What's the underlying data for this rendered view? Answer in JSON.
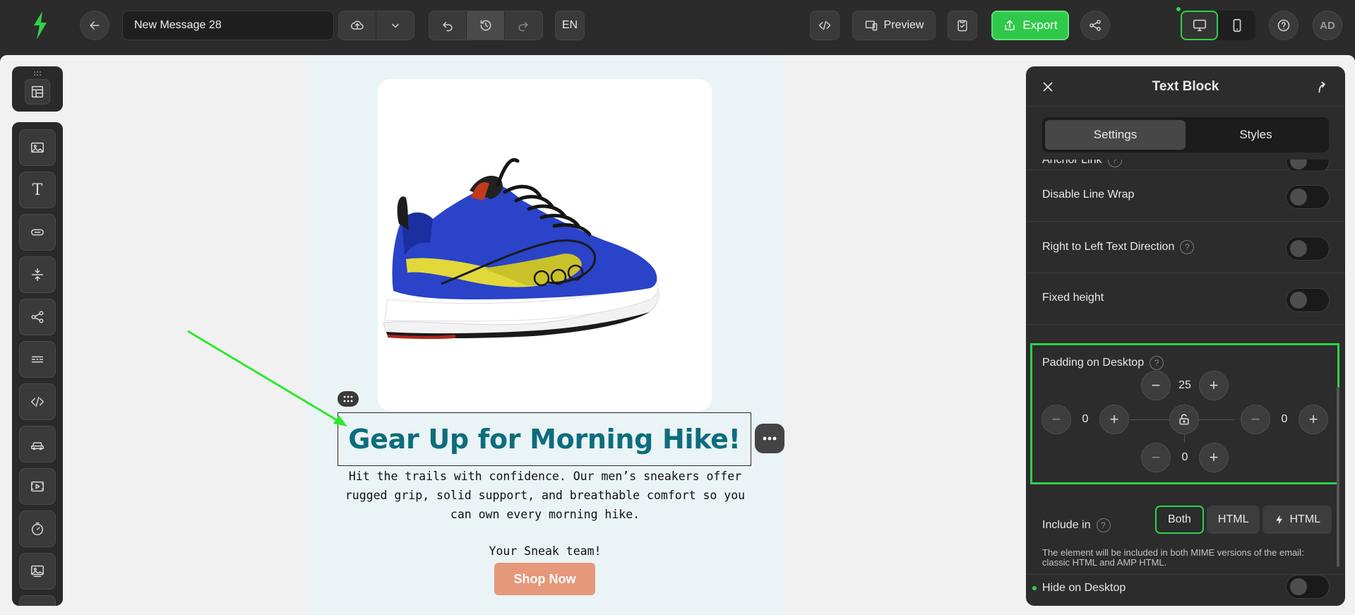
{
  "topbar": {
    "message_title": "New Message 28",
    "language": "EN",
    "preview_label": "Preview",
    "export_label": "Export",
    "avatar_initials": "AD"
  },
  "canvas": {
    "headline": "Gear Up for Morning Hike!",
    "body": "Hit the trails with confidence. Our men’s sneakers offer rugged grip, solid support, and breathable comfort so you can own every morning hike.",
    "signoff": "Your Sneak team!",
    "cta_label": "Shop Now"
  },
  "panel": {
    "title": "Text Block",
    "tabs": [
      {
        "label": "Settings"
      },
      {
        "label": "Styles"
      }
    ],
    "settings": {
      "anchor_link": "Anchor Link",
      "disable_line_wrap": "Disable Line Wrap",
      "rtl_direction": "Right to Left Text Direction",
      "fixed_height": "Fixed height",
      "padding_label": "Padding on Desktop",
      "padding": {
        "top": "25",
        "left": "0",
        "right": "0",
        "bottom": "0"
      },
      "include_in_label": "Include in",
      "include_options": [
        "Both",
        "HTML",
        "HTML"
      ],
      "include_note": "The element will be included in both MIME versions of the email: classic HTML and AMP HTML.",
      "hide_on_desktop": "Hide on Desktop"
    }
  },
  "colors": {
    "accent_green": "#2fd14b",
    "headline_teal": "#0c6d7c",
    "cta_orange": "#e6987a"
  }
}
